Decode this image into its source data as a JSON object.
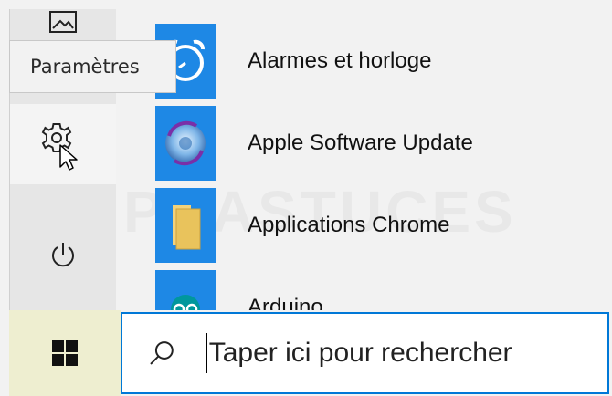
{
  "tooltip": {
    "text": "Paramètres"
  },
  "sidebar": {
    "items": [
      {
        "name": "pictures",
        "icon": "pictures-icon"
      },
      {
        "name": "settings",
        "icon": "gear-icon"
      },
      {
        "name": "power",
        "icon": "power-icon"
      }
    ]
  },
  "apps": [
    {
      "label": "Alarmes et horloge",
      "icon": "alarm-clock-icon",
      "tile_color": "#1e88e5"
    },
    {
      "label": "Apple Software Update",
      "icon": "apple-update-icon",
      "tile_color": "#1e88e5"
    },
    {
      "label": "Applications Chrome",
      "icon": "folder-icon",
      "tile_color": "#1e88e5"
    },
    {
      "label": "Arduino",
      "icon": "arduino-icon",
      "tile_color": "#1e88e5"
    }
  ],
  "taskbar": {
    "start_icon": "windows-logo-icon",
    "search": {
      "placeholder": "Taper ici pour rechercher",
      "icon": "search-icon"
    }
  },
  "colors": {
    "accent": "#0078d7",
    "tile": "#1e88e5"
  }
}
